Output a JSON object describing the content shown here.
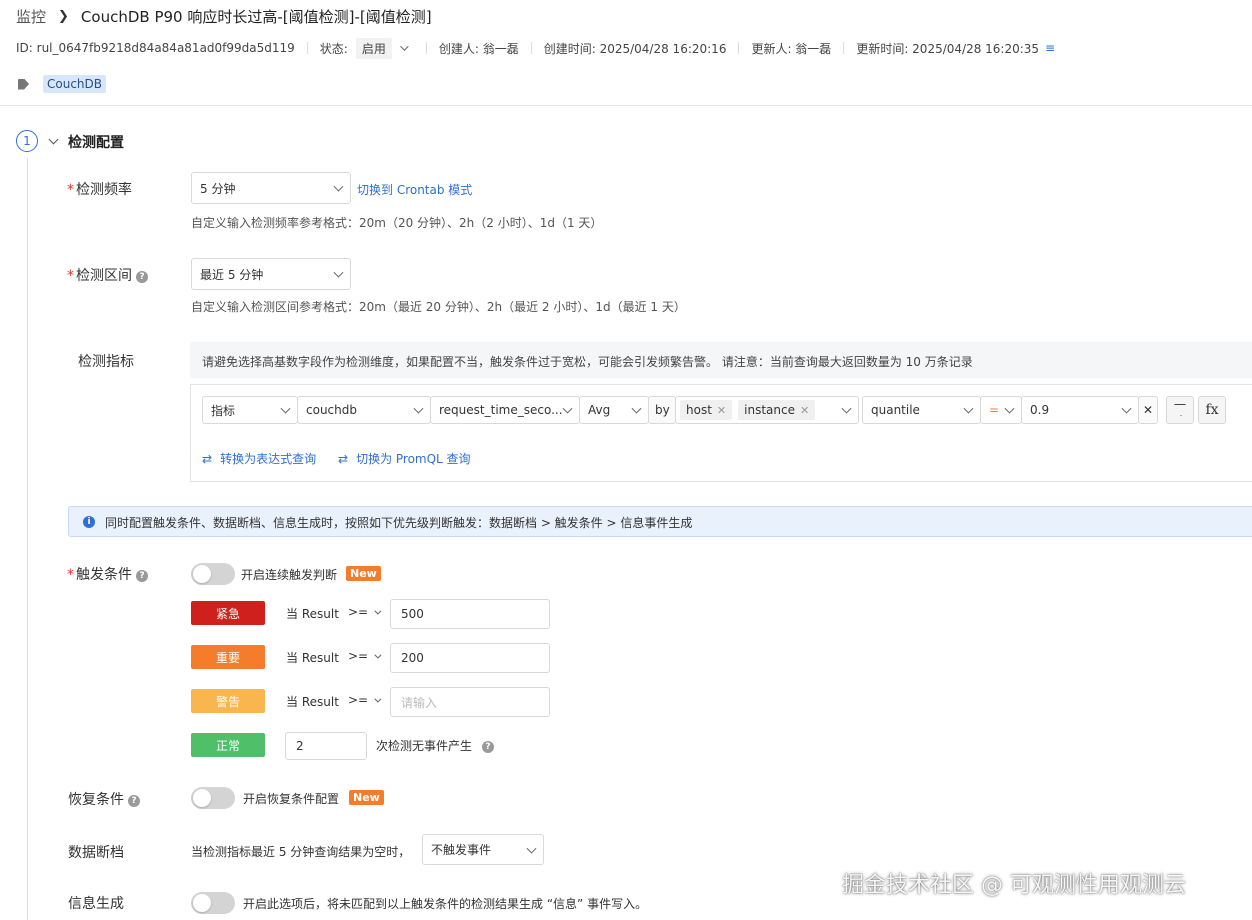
{
  "breadcrumb": {
    "root": "监控",
    "separator": ">",
    "title": "CouchDB P90 响应时长过高-[阈值检测]-[阈值检测]"
  },
  "meta": {
    "id": "ID: rul_0647fb9218d84a84a81ad0f99da5d119",
    "status_label": "状态:",
    "status_value": "启用",
    "creator": "创建人: 翁一磊",
    "created_at": "创建时间: 2025/04/28 16:20:16",
    "updater": "更新人: 翁一磊",
    "updated_at": "更新时间: 2025/04/28 16:20:35"
  },
  "tag": "CouchDB",
  "section": {
    "step": "1",
    "title": "检测配置"
  },
  "frequency": {
    "label": "检测频率",
    "value": "5 分钟",
    "switch_link": "切换到 Crontab 模式",
    "hint": "自定义输入检测频率参考格式：20m（20 分钟）、2h（2 小时）、1d（1 天）"
  },
  "interval": {
    "label": "检测区间",
    "value": "最近 5 分钟",
    "hint": "自定义输入检测区间参考格式：20m（最近 20 分钟）、2h（最近 2 小时）、1d（最近 1 天）"
  },
  "metric": {
    "label": "检测指标",
    "notice": "请避免选择高基数字段作为检测维度，如果配置不当，触发条件过于宽松，可能会引发频繁告警。 请注意：当前查询最大返回数量为 10 万条记录",
    "type": "指标",
    "measurement": "couchdb",
    "field": "request_time_seco...",
    "agg": "Avg",
    "by": "by",
    "group_tags": [
      "host",
      "instance"
    ],
    "func": "quantile",
    "op": "=",
    "value": "0.9",
    "fx": "fx",
    "to_expr": "转换为表达式查询",
    "to_promql": "切换为 PromQL 查询"
  },
  "info_banner": "同时配置触发条件、数据断档、信息生成时，按照如下优先级判断触发：数据断档 > 触发条件 > 信息事件生成",
  "trigger": {
    "label": "触发条件",
    "continuous": "开启连续触发判断",
    "new": "New",
    "rules": [
      {
        "level": "紧急",
        "color": "#d0201b",
        "when": "当 Result",
        "op": ">=",
        "value": "500",
        "placeholder": ""
      },
      {
        "level": "重要",
        "color": "#f57c2b",
        "when": "当 Result",
        "op": ">=",
        "value": "200",
        "placeholder": ""
      },
      {
        "level": "警告",
        "color": "#f9b54e",
        "when": "当 Result",
        "op": ">=",
        "value": "",
        "placeholder": "请输入"
      }
    ],
    "normal": {
      "level": "正常",
      "color": "#4fbf6a",
      "count": "2",
      "suffix": "次检测无事件产生"
    }
  },
  "recovery": {
    "label": "恢复条件",
    "toggle_text": "开启恢复条件配置",
    "new": "New"
  },
  "nodata": {
    "label": "数据断档",
    "text": "当检测指标最近 5 分钟查询结果为空时，",
    "value": "不触发事件"
  },
  "info_gen": {
    "label": "信息生成",
    "text": "开启此选项后，将未匹配到以上触发条件的检测结果生成 “信息” 事件写入。"
  },
  "watermark": "掘金技术社区 @ 可观测性用观测云"
}
